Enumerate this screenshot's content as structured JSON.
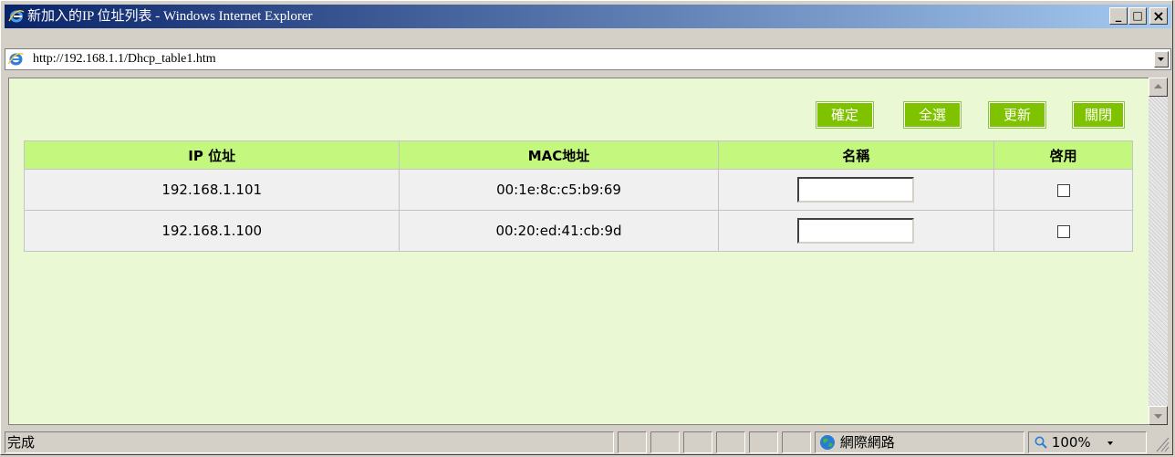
{
  "window": {
    "title": "新加入的IP 位址列表 - Windows Internet Explorer",
    "minimize": "_",
    "maximize": "□",
    "close": "×"
  },
  "address_bar": {
    "url": "http://192.168.1.1/Dhcp_table1.htm"
  },
  "toolbar": {
    "confirm_label": "確定",
    "select_all_label": "全選",
    "refresh_label": "更新",
    "close_label": "關閉"
  },
  "table": {
    "headers": [
      "IP 位址",
      "MAC地址",
      "名稱",
      "啓用"
    ],
    "rows": [
      {
        "ip": "192.168.1.101",
        "mac": "00:1e:8c:c5:b9:69",
        "name": "",
        "enabled": false
      },
      {
        "ip": "192.168.1.100",
        "mac": "00:20:ed:41:cb:9d",
        "name": "",
        "enabled": false
      }
    ]
  },
  "status_bar": {
    "status_text": "完成",
    "zone": "網際網路",
    "zoom": "100%",
    "zone_icon": "globe-icon",
    "zoom_icon": "magnifier-icon"
  },
  "colors": {
    "content_bg": "#eaf8d3",
    "header_bg": "#c3f77d",
    "button_bg": "#7fc300",
    "titlebar_start": "#0a246a",
    "titlebar_end": "#a6caf0"
  }
}
